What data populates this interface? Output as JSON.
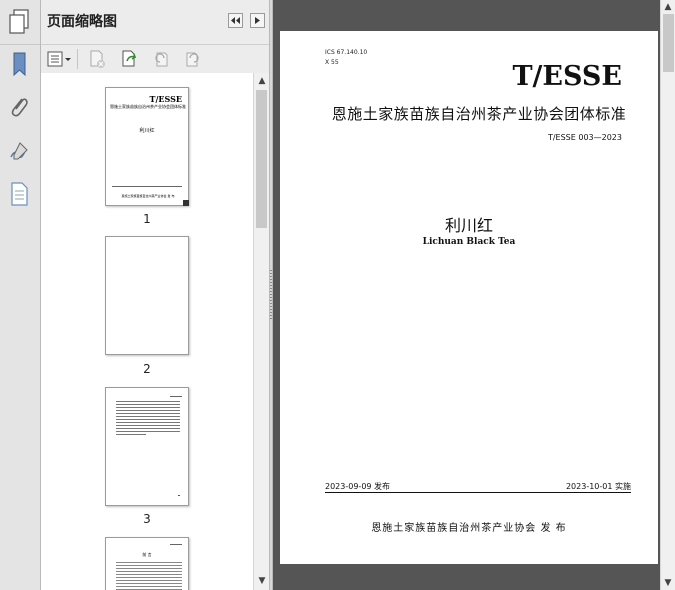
{
  "panel": {
    "title": "页面缩略图"
  },
  "thumbnails": [
    {
      "page_label": "1",
      "mini_code": "T/ESSE",
      "mini_org": "恩施土家族苗族自治州茶产业协会团体标准",
      "mini_title": "利川红",
      "mini_publisher": "恩施土家族苗族自治州茶产业协会 发 布"
    },
    {
      "page_label": "2"
    },
    {
      "page_label": "3"
    },
    {
      "page_label": "",
      "mini_heading": "前 言"
    }
  ],
  "document": {
    "ics": "ICS 67.140.10",
    "ccs": "X 55",
    "code": "T/ESSE",
    "org_standard": "恩施土家族苗族自治州茶产业协会团体标准",
    "number": "T/ESSE 003—2023",
    "title_cn": "利川红",
    "title_en": "Lichuan Black Tea",
    "publish_date": "2023-09-09 发布",
    "effective_date": "2023-10-01 实施",
    "publisher": "恩施土家族苗族自治州茶产业协会 发 布"
  },
  "colors": {
    "panel_bg": "#ececec",
    "doc_bg": "#555555",
    "page_bg": "#ffffff"
  }
}
